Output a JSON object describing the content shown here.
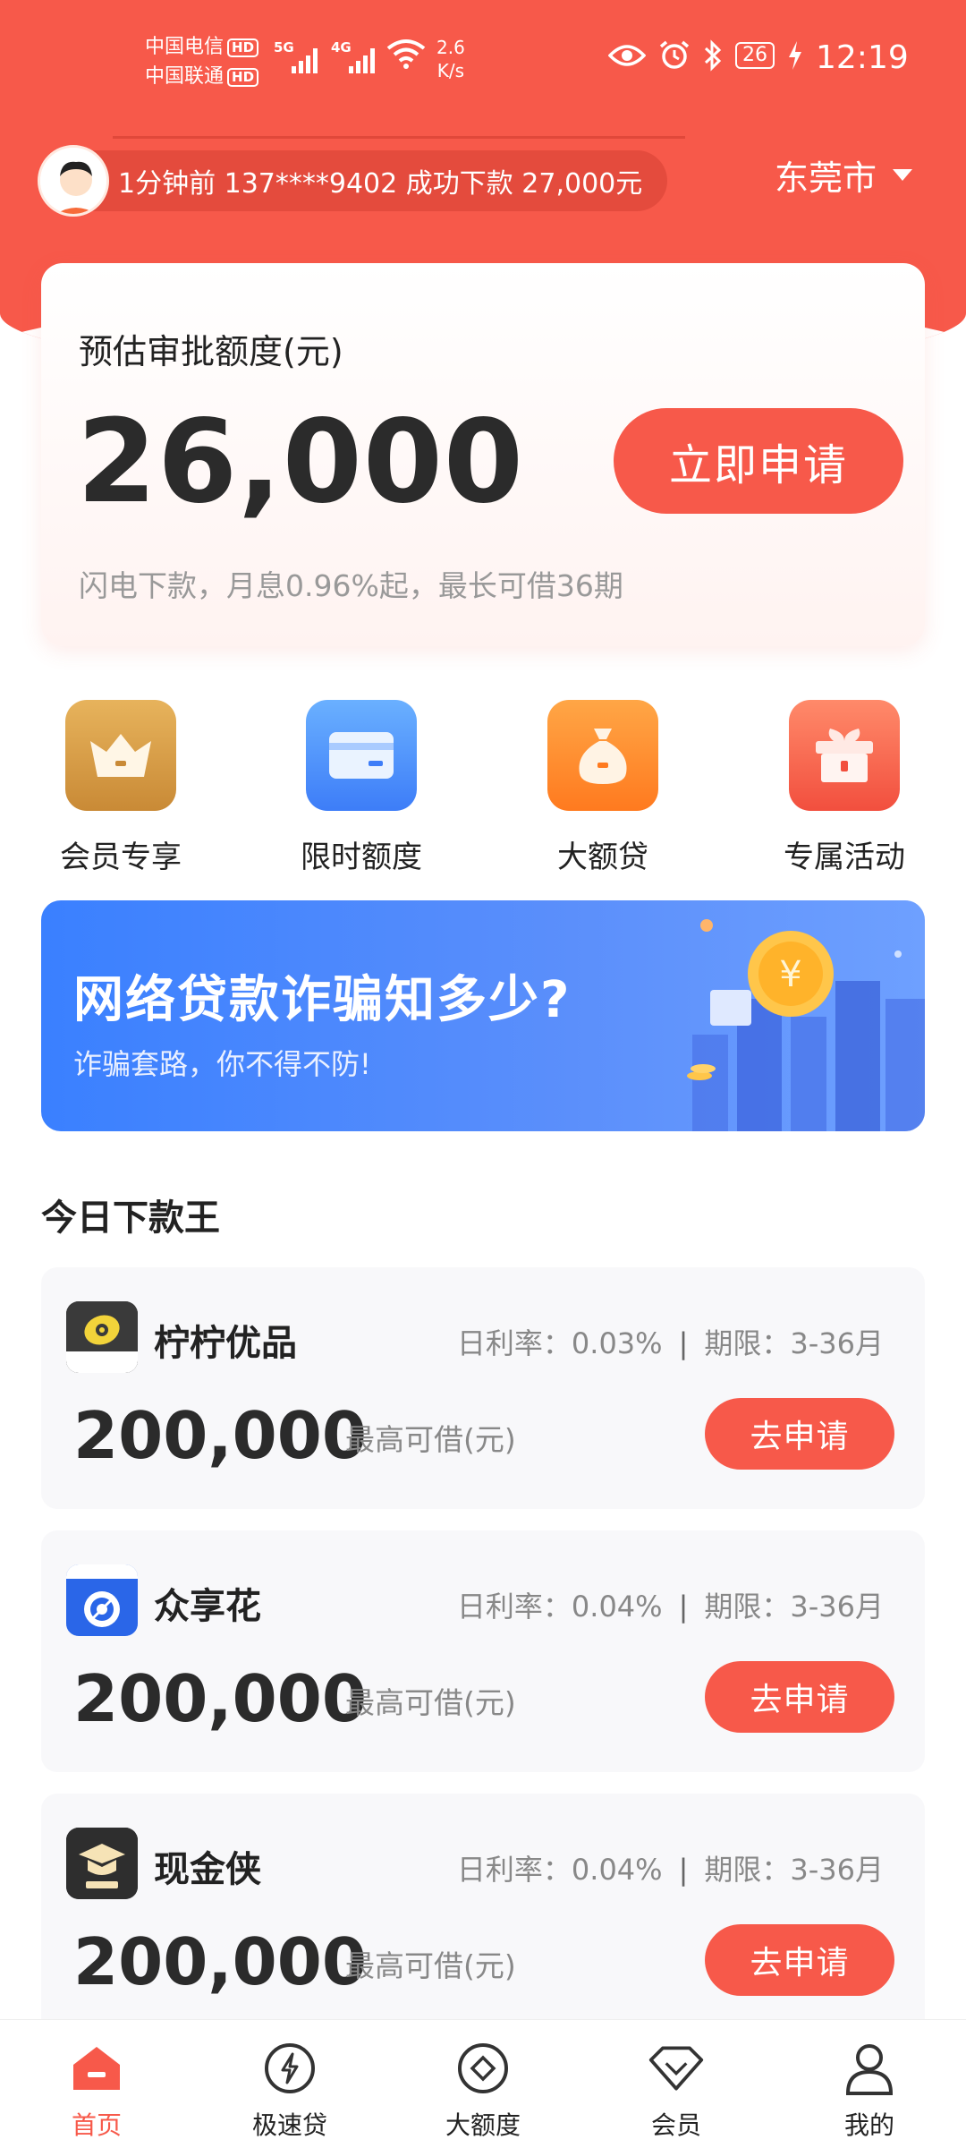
{
  "status_bar": {
    "carrier1": "中国电信",
    "carrier2": "中国联通",
    "hd": "HD",
    "net1": "5G",
    "net2": "4G",
    "speed_value": "2.6",
    "speed_unit": "K/s",
    "battery": "26",
    "time": "12:19"
  },
  "header": {
    "ticker": "1分钟前 137****9402  成功下款 27,000元",
    "city": "东莞市"
  },
  "quota_card": {
    "label": "预估审批额度(元)",
    "amount": "26,000",
    "apply_label": "立即申请",
    "desc": "闪电下款，月息0.96%起，最长可借36期"
  },
  "quick_entries": [
    {
      "label": "会员专享",
      "icon": "crown-icon",
      "color": "#d9a04a"
    },
    {
      "label": "限时额度",
      "icon": "card-icon",
      "color": "#4d8ffd"
    },
    {
      "label": "大额贷",
      "icon": "money-bag-icon",
      "color": "#ff8a2a"
    },
    {
      "label": "专属活动",
      "icon": "gift-icon",
      "color": "#f7594a"
    }
  ],
  "banner": {
    "title": "网络贷款诈骗知多少?",
    "subtitle": "诈骗套路，你不得不防!"
  },
  "section_title": "今日下款王",
  "loans": [
    {
      "name": "柠柠优品",
      "logo_text": "柠柠优品",
      "rate": "日利率：0.03%",
      "term": "期限：3-36月",
      "amount": "200,000",
      "amount_label": "最高可借(元)",
      "apply": "去申请"
    },
    {
      "name": "众享花",
      "logo_text": "众享花",
      "rate": "日利率：0.04%",
      "term": "期限：3-36月",
      "amount": "200,000",
      "amount_label": "最高可借(元)",
      "apply": "去申请"
    },
    {
      "name": "现金侠",
      "logo_text": "现金侠",
      "rate": "日利率：0.04%",
      "term": "期限：3-36月",
      "amount": "200,000",
      "amount_label": "最高可借(元)",
      "apply": "去申请"
    }
  ],
  "tabbar": [
    {
      "label": "首页",
      "icon": "home-icon",
      "active": true
    },
    {
      "label": "极速贷",
      "icon": "lightning-icon",
      "active": false
    },
    {
      "label": "大额度",
      "icon": "diamond-circle-icon",
      "active": false
    },
    {
      "label": "会员",
      "icon": "gem-icon",
      "active": false
    },
    {
      "label": "我的",
      "icon": "user-icon",
      "active": false
    }
  ],
  "colors": {
    "brand": "#f7594a",
    "banner": "#3a80ff"
  }
}
